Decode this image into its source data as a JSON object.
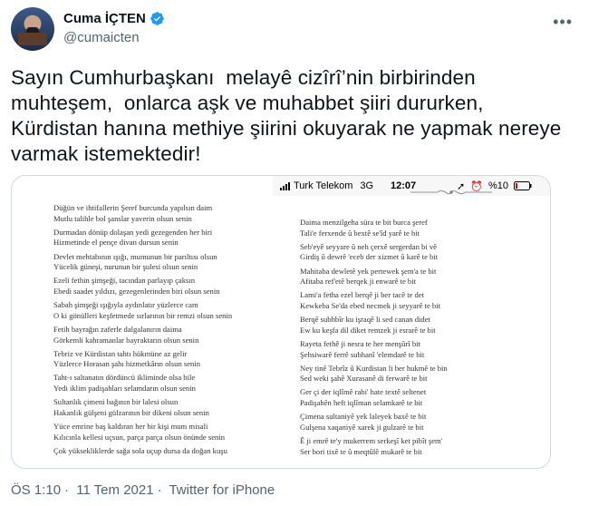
{
  "author": {
    "name": "Cuma İÇTEN",
    "handle": "@cumaicten"
  },
  "tweet": {
    "text": "Sayın Cumhurbaşkanı  melayê cizîrî’nin birbirinden muhteşem,  onlarca aşk ve muhabbet şiiri dururken, Kürdistan hanına methiye şiirini okuyarak ne yapmak nereye varmak istemektedir!"
  },
  "media": {
    "status_bar": {
      "carrier": "Turk Telekom",
      "network": "3G",
      "time": "12:07",
      "battery": "%10"
    },
    "poem_left": [
      [
        "Düğün ve ihtifallerin Şeref burcunda yapılsın daim",
        "Mutlu talihle bol şanslar yaverin olsun senin"
      ],
      [
        "Durmadan dönüp dolaşan yedi gezegenden her biri",
        "Hizmetinde el pençe divan dursun senin"
      ],
      [
        "Devlet mehtabının ışığı, mumunun bir parıltısı olsun",
        "Yücelik güneşi, nurunun bir şulesi olsun senin"
      ],
      [
        "Ezeli fethin şimşeği, tacından parlayıp çaksın",
        "Ebedi saadet yıldızı, gezegenlerinden biri olsun senin"
      ],
      [
        "Sabah şimşeği ışığıyla aydınlatır yüzlerce cam",
        "O ki gönülleri keşfetmede sırlarının bir remzi olsun senin"
      ],
      [
        "Fetih bayrağın zaferle dalgalanırın daima",
        "Görkemli kahramanlar bayraktarın olsun senin"
      ],
      [
        "Tebriz ve Kürdistan tahtı hükmüne az gelir",
        "Yüzlerce Horasan şahı hizmetkârın olsun senin"
      ],
      [
        "Taht-ı saltanatın dördüncü ikliminde olsa bile",
        "Yedi iklim padişahları selamdarın olsun senin"
      ],
      [
        "Sultanlık çimeni bağının bir lalesi olsun",
        "Hakanlık gülşeni gülzarının bir dikeni olsun senin"
      ],
      [
        "Yüce emrine baş kaldıran her bir kişi mum misali",
        "Kılıcınla kellesi uçsun, parça parça olsun önünde senin"
      ],
      [
        "Çok yüksekliklerde sağa sola uçup dursa da doğan kuşu",
        ""
      ]
    ],
    "poem_right": [
      [
        "Daima menzilgeha süra te bit burca şeref",
        "Tali'e ferxende û bextê se'îd yarê te bit"
      ],
      [
        "Seb'eyê seyyare û neh çerxê sergerdan bi vê",
        "Girdiş û dewrê 'eceb der xizmet û karê te bit"
      ],
      [
        "Mahitaba dewletê yek pertewek şem'a te bit",
        "Afitaba ref'etê berqek ji enwarê te bit"
      ],
      [
        "Lami'a fetha ezel berqê ji ber tacê te det",
        "Kewkeba Se'da ebed necmek ji seyyarê te bit"
      ],
      [
        "Berqê subhbîr ku işraqê li sed canan didet",
        "Ew ku keşfa dil diket remzek ji esrarê te bit"
      ],
      [
        "Rayeta fethê ji nesra te her menşûrî bit",
        "Şehsiwarê ferrê subhanî 'elemdarê te bit"
      ],
      [
        "Ney tinê Tebrîz û Kurdistan li ber hukmê te bin",
        "Sed weki şahê Xurasanê di ferwarê te bit"
      ],
      [
        "Ger çi der iqlîmê rabi' hate textê seltenet",
        "Padişahên heft iqlîman selamkarê te bit"
      ],
      [
        "Çimena sultaniyê yek laleyek baxê te bit",
        "Gulşena xaqaniyê xarek ji gulzarê te bit"
      ],
      [
        "Ê ji emrê te'y mukerrem serkeşî ket pibît şem'",
        "Ser bori tixê te û meqtûlê mukarê te bit"
      ]
    ]
  },
  "footer": {
    "time": "ÖS 1:10",
    "date": "11 Tem 2021",
    "source": "Twitter for iPhone"
  },
  "colors": {
    "verified": "#1d9bf0",
    "muted": "#536471",
    "text": "#0f1419"
  }
}
